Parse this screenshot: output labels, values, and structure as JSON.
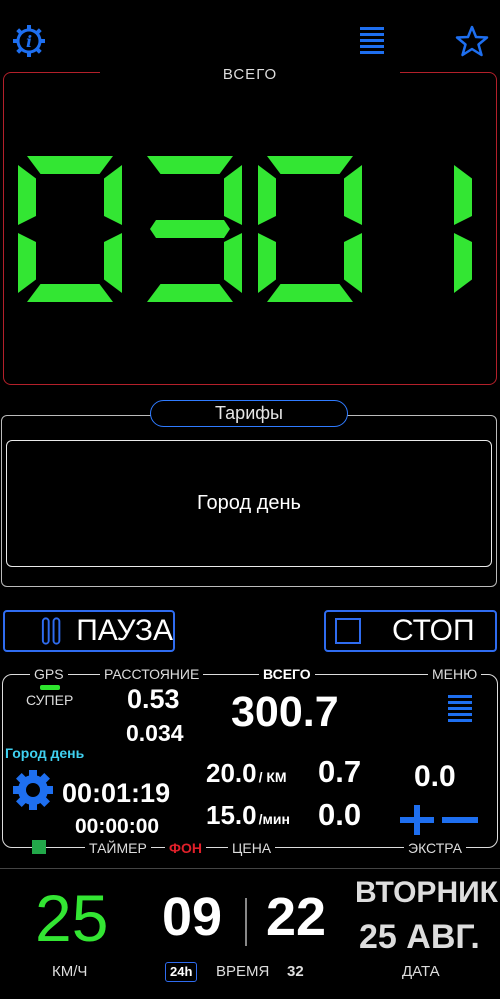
{
  "header": {
    "info_icon": "info-gear-icon",
    "menu_icon": "menu-lines-icon",
    "favorite_icon": "star-icon"
  },
  "meter": {
    "title": "ВСЕГО",
    "digits": "0301",
    "color": "#33e633"
  },
  "tariffs": {
    "title": "Тарифы",
    "current": "Город день"
  },
  "controls": {
    "pause_label": "ПАУЗА",
    "stop_label": "СТОП"
  },
  "panel": {
    "gps_label": "GPS",
    "distance_label": "РАССТОЯНИЕ",
    "total_label": "ВСЕГО",
    "menu_label": "МЕНЮ",
    "signal_label": "СУПЕР",
    "distance_main": "0.53",
    "distance_sub": "0.034",
    "total_value": "300.7",
    "tariff_name": "Город день",
    "timer_main": "00:01:19",
    "timer_sub": "00:00:00",
    "rate_km_value": "20.0",
    "rate_km_unit": "/ КМ",
    "rate_km_sum": "0.7",
    "rate_min_value": "15.0",
    "rate_min_unit": "/мин",
    "rate_min_sum": "0.0",
    "extra_value": "0.0",
    "timer_label": "ТАЙМЕР",
    "bg_label": "ФОН",
    "price_label": "ЦЕНА",
    "extra_label": "ЭКСТРА"
  },
  "bottom": {
    "speed": "25",
    "speed_unit": "КМ/Ч",
    "hours": "09",
    "minutes": "22",
    "format_badge": "24h",
    "time_label": "ВРЕМЯ",
    "seconds": "32",
    "weekday": "ВТОРНИК",
    "date": "25 АВГ.",
    "date_label": "ДАТА"
  }
}
